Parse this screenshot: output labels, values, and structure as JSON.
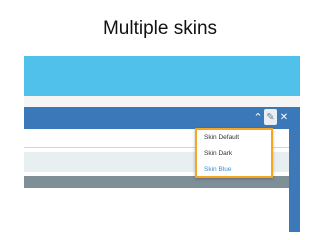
{
  "slide": {
    "title": "Multiple skins"
  },
  "header": {
    "collapse_glyph": "⌃",
    "edit_glyph": "✎",
    "close_glyph": "✕"
  },
  "skin_menu": {
    "items": [
      {
        "label": "Skin Default"
      },
      {
        "label": "Skin Dark"
      },
      {
        "label": "Skin Blue"
      }
    ],
    "selected": "Skin Blue"
  },
  "colors": {
    "banner": "#4fc1ea",
    "panel_header": "#3b78ba",
    "menu_border": "#f5a623",
    "selected_item": "#3b8fd9"
  }
}
